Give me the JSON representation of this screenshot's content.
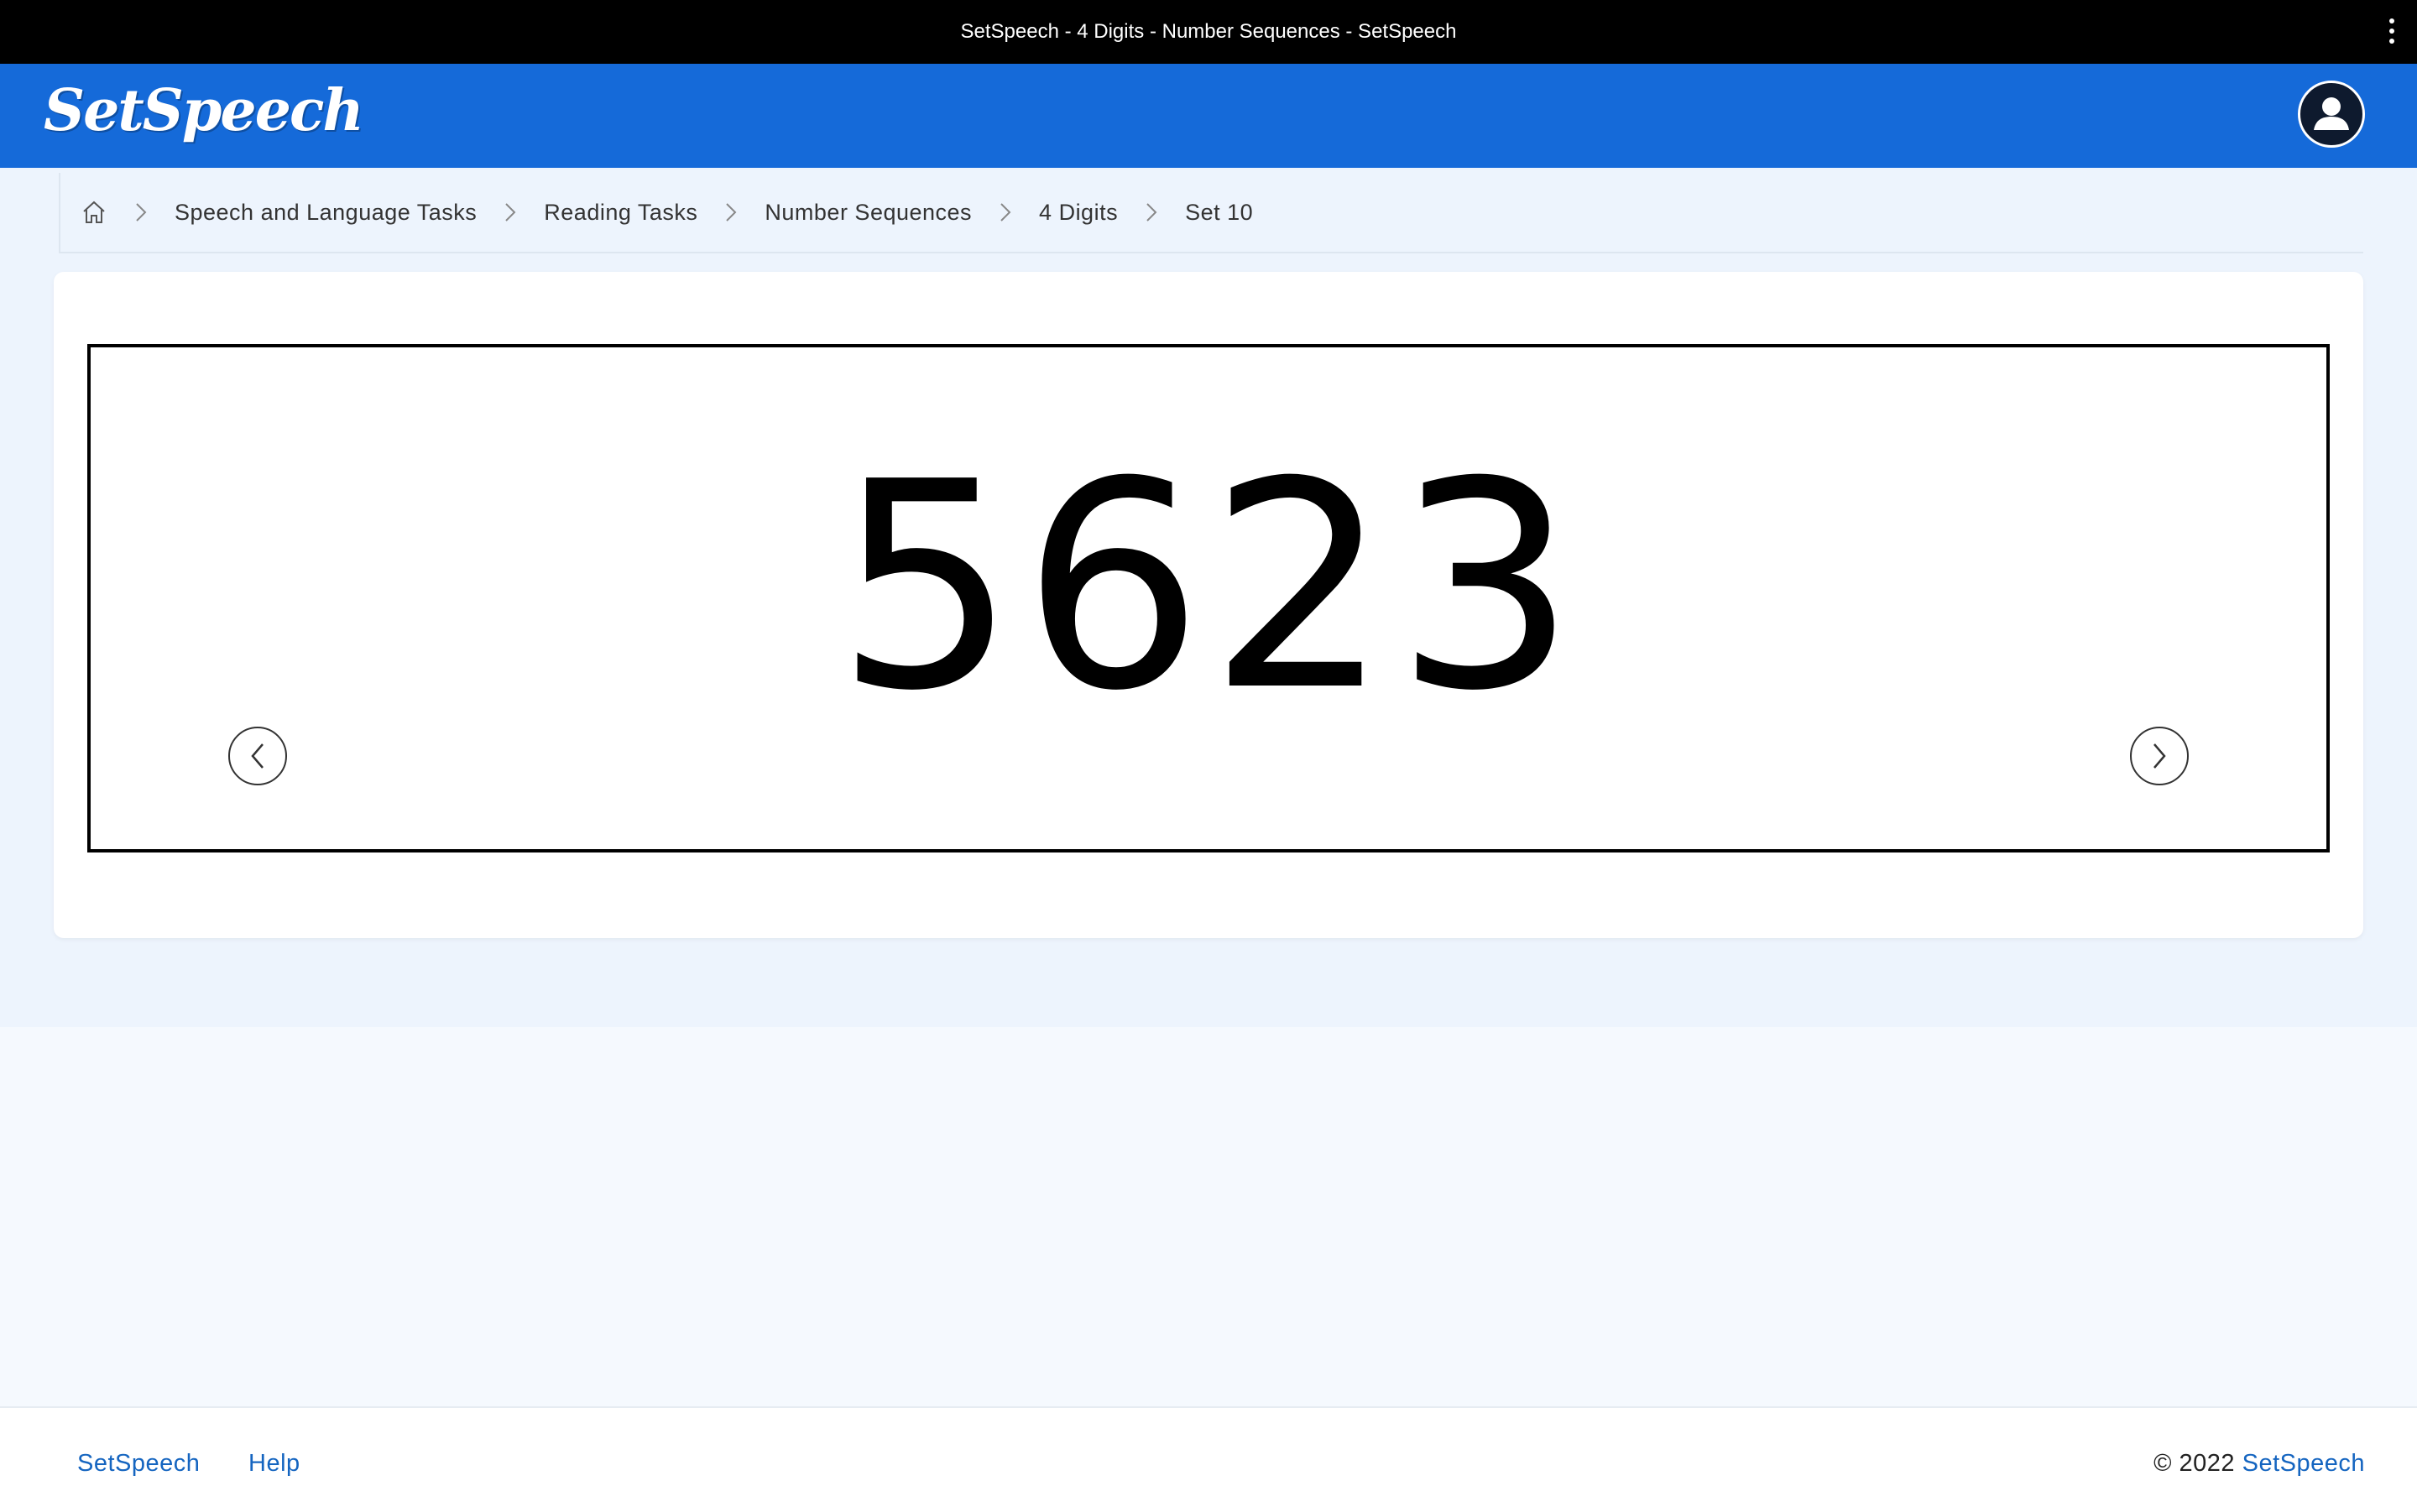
{
  "window": {
    "title": "SetSpeech - 4 Digits - Number Sequences - SetSpeech",
    "menu_icon": "more-vertical-icon"
  },
  "header": {
    "logo": "SetSpeech",
    "avatar_icon": "user-avatar-icon",
    "brand_color": "#156ad9"
  },
  "breadcrumb": {
    "home_icon": "home-icon",
    "separator_icon": "chevron-right-icon",
    "items": [
      "Speech and Language Tasks",
      "Reading Tasks",
      "Number Sequences",
      "4 Digits",
      "Set 10"
    ]
  },
  "card": {
    "number": "5623",
    "prev_icon": "chevron-left-circle-icon",
    "next_icon": "chevron-right-circle-icon"
  },
  "footer": {
    "links": [
      "SetSpeech",
      "Help"
    ],
    "copyright_prefix": "© 2022",
    "copyright_brand": "SetSpeech",
    "link_color": "#1565c0"
  }
}
